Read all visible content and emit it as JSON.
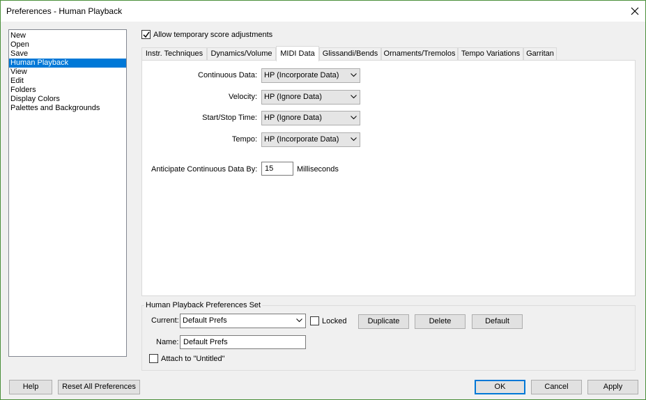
{
  "window": {
    "title": "Preferences - Human Playback"
  },
  "categories": [
    {
      "label": "New"
    },
    {
      "label": "Open"
    },
    {
      "label": "Save"
    },
    {
      "label": "Human Playback"
    },
    {
      "label": "View"
    },
    {
      "label": "Edit"
    },
    {
      "label": "Folders"
    },
    {
      "label": "Display Colors"
    },
    {
      "label": "Palettes and Backgrounds"
    }
  ],
  "selected_category": "Human Playback",
  "allow_temp": {
    "label": "Allow temporary score adjustments",
    "checked": true
  },
  "tabs": [
    {
      "label": "Instr. Techniques"
    },
    {
      "label": "Dynamics/Volume"
    },
    {
      "label": "MIDI Data"
    },
    {
      "label": "Glissandi/Bends"
    },
    {
      "label": "Ornaments/Tremolos"
    },
    {
      "label": "Tempo Variations"
    },
    {
      "label": "Garritan"
    }
  ],
  "active_tab": "MIDI Data",
  "midi": {
    "continuous": {
      "label": "Continuous Data:",
      "value": "HP (Incorporate Data)"
    },
    "velocity": {
      "label": "Velocity:",
      "value": "HP (Ignore Data)"
    },
    "startstop": {
      "label": "Start/Stop Time:",
      "value": "HP (Ignore Data)"
    },
    "tempo": {
      "label": "Tempo:",
      "value": "HP (Incorporate Data)"
    },
    "anticipate": {
      "label": "Anticipate Continuous Data By:",
      "value": "15",
      "unit": "Milliseconds"
    }
  },
  "prefs_set": {
    "title": "Human Playback Preferences Set",
    "current_label": "Current:",
    "current_value": "Default Prefs",
    "locked_label": "Locked",
    "locked_checked": false,
    "duplicate": "Duplicate",
    "delete": "Delete",
    "default": "Default",
    "name_label": "Name:",
    "name_value": "Default Prefs",
    "attach_label": "Attach to \"Untitled\"",
    "attach_checked": false
  },
  "footer": {
    "help": "Help",
    "reset": "Reset All Preferences",
    "ok": "OK",
    "cancel": "Cancel",
    "apply": "Apply"
  },
  "colors": {
    "selection": "#0078d7",
    "window_border": "#4a8f3a"
  },
  "icons": {
    "close": "close-icon",
    "dropdown": "chevron-down-icon",
    "check": "checkmark-icon"
  }
}
